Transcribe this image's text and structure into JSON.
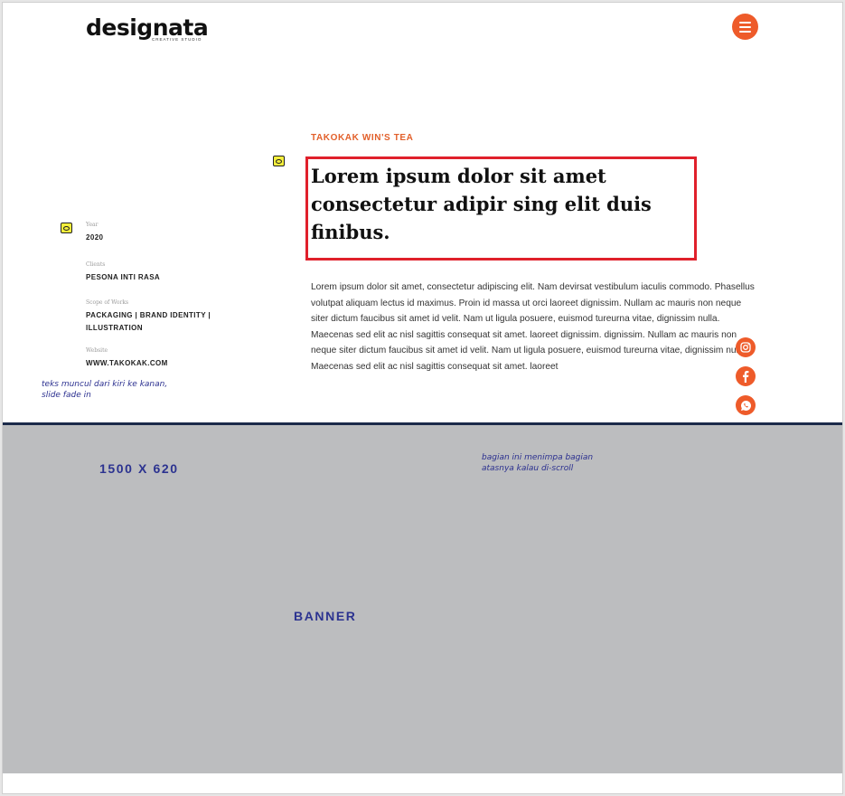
{
  "header": {
    "logo_text": "designata",
    "logo_subtext": "CREATIVE STUDIO",
    "menu_icon": "hamburger-menu-icon",
    "accent_color": "#ee5b2a"
  },
  "project": {
    "eyebrow": "TAKOKAK WIN'S TEA",
    "heading": "Lorem ipsum dolor sit amet consectetur adipir sing elit duis finibus.",
    "body": "Lorem ipsum dolor sit amet, consectetur adipiscing elit. Nam devirsat vestibulum iaculis commodo. Phasellus volutpat aliquam lectus id maximus. Proin id massa ut orci laoreet dignissim. Nullam ac mauris non neque siter dictum faucibus sit amet id velit. Nam ut ligula posuere, euismod tureurna vitae, dignissim nulla. Maecenas sed elit ac nisl sagittis consequat sit amet. laoreet dignissim. dignissim. Nullam ac mauris non neque siter dictum faucibus sit amet id velit. Nam ut ligula posuere, euismod tureurna vitae, dignissim nulla. Maecenas sed elit ac nisl sagittis consequat sit amet. laoreet"
  },
  "meta": {
    "year_label": "Year",
    "year_value": "2020",
    "clients_label": "Clients",
    "clients_value": "PESONA INTI RASA",
    "scope_label": "Scope of Works",
    "scope_value": "PACKAGING | BRAND IDENTITY | ILLUSTRATION",
    "website_label": "Website",
    "website_value": "WWW.TAKOKAK.COM"
  },
  "notes": {
    "left_note": "teks muncul dari kiri ke kanan, slide fade in",
    "banner_note": "bagian ini menimpa bagian atasnya kalau di-scroll"
  },
  "social": {
    "icons": [
      "instagram-icon",
      "facebook-icon",
      "whatsapp-icon"
    ]
  },
  "banner": {
    "size_label": "1500 X 620",
    "label": "BANNER",
    "background": "#bcbdbf"
  }
}
